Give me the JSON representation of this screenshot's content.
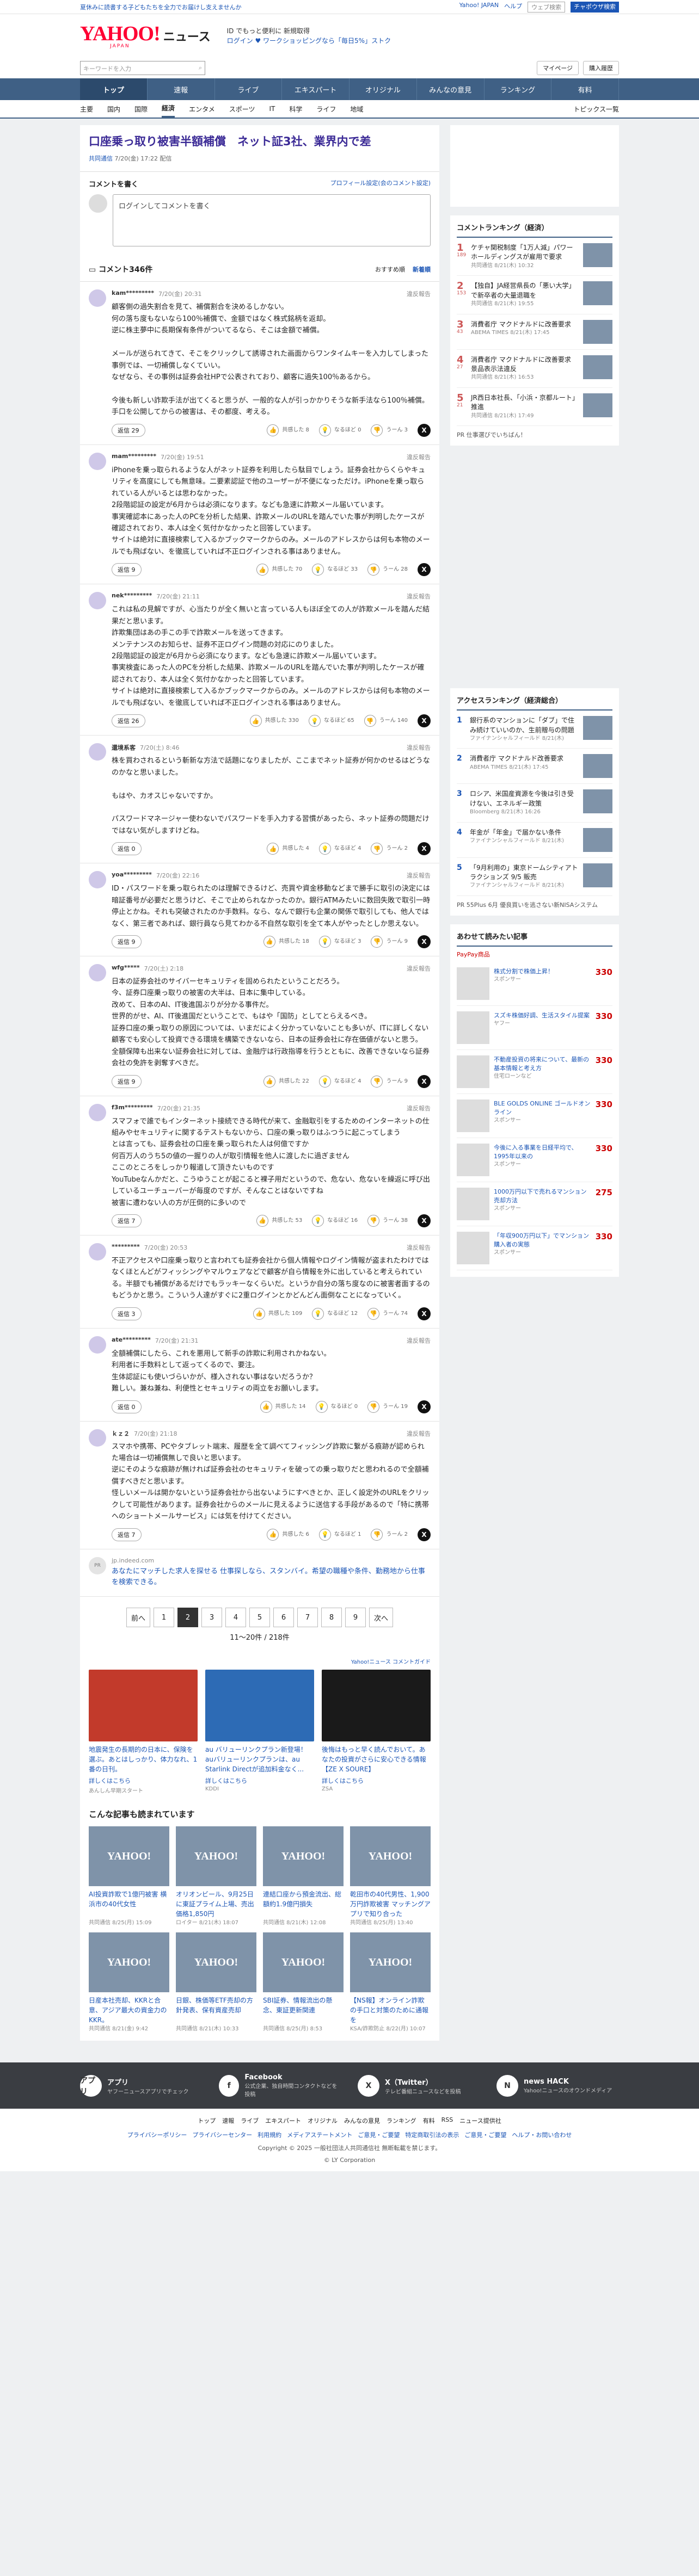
{
  "topbar": {
    "promo": "夏休みに読書する子どもたちを全力でお届けし支えませんか",
    "links": [
      "Yahoo! JAPAN",
      "ヘルプ"
    ],
    "search_placeholder": "ウェブ検索",
    "search_btn": "チャポウザ検索"
  },
  "header": {
    "logo": "YAHOO!",
    "logo_sub": "JAPAN",
    "suffix": "ニュース",
    "promo1": "ID でもっと便利に 新規取得",
    "promo2": "ログイン  ♥ ワークショッピングなら「毎日5%」ストク"
  },
  "searchrow": {
    "placeholder": "キーワードを入力",
    "mypage": "マイページ",
    "buy": "購入履歴"
  },
  "nav": [
    "トップ",
    "速報",
    "ライブ",
    "エキスパート",
    "オリジナル",
    "みんなの意見",
    "ランキング",
    "有料"
  ],
  "subnav": [
    "主要",
    "国内",
    "国際",
    "経済",
    "エンタメ",
    "スポーツ",
    "IT",
    "科学",
    "ライフ",
    "地域"
  ],
  "subnav_right": "トピックス一覧",
  "article": {
    "title": "口座乗っ取り被害半額補償　ネット証3社、業界内で差",
    "source": "共同通信",
    "date": "7/20(金) 17:22 配信"
  },
  "comment_form": {
    "label": "コメントを書く",
    "profile": "プロフィール設定(会のコメント設定)",
    "placeholder": "ログインしてコメントを書く"
  },
  "comments_bar": {
    "title": "コメント346件",
    "sort1": "おすすめ順",
    "sort2": "新着順"
  },
  "comments": [
    {
      "name": "kam*********",
      "date": "7/20(金) 20:31",
      "report": "違反報告",
      "text": "顧客側の過失割合を見て、補償割合を決めるしかない。\n何の落ち度もないなら100％補償で、金額ではなく株式銘柄を返却。\n逆に株主夢中に長期保有条件がついてるなら、そこは金額で補償。\n\nメールが送られてきて、そこをクリックして誘導された画面からワンタイムキーを入力してしまった事例では、一切補償しなくていい。\nなぜなら、その事例は証券会社HPで公表されており、顧客に過失100％あるから。\n\n今後も新しい詐欺手法が出てくると思うが、一般的な人が引っかかりそうな新手法なら100％補償。\n手口を公開してからの被害は、その都度、考える。",
      "replies": "返信 29",
      "good": "共感した 8",
      "good_n": "8",
      "hmm": "なるほど 0",
      "hmm_n": "0",
      "bad": "うーん 3",
      "bad_n": "3"
    },
    {
      "name": "mam*********",
      "date": "7/20(金) 19:51",
      "report": "違反報告",
      "text": "iPhoneを乗っ取られるような人がネット証券を利用したら駄目でしょう。証券会社からくらやキュリティを高度にしても無意味。二要素認証で他のユーザーが不便になっただけ。iPhoneを乗っ取られている人がいるとは思わなかった。\n2段階認証の設定が6月からは必須になります。なども急速に詐欺メール届いています。\n事実確認本にあった人のPCを分析した結果、詐欺メールのURLを踏んでいた事が判明したケースが確認されており、本人は全く気付かなかったと回答しています。\nサイトは絶対に直接検索して入るかブックマークからのみ。メールのアドレスからは何も本物のメールでも飛ばない、を徹底していれば不正ログインされる事はありません。",
      "replies": "返信 9",
      "good": "共感した 70",
      "good_n": "70",
      "hmm": "なるほど 33",
      "hmm_n": "33",
      "bad": "うーん 28",
      "bad_n": "28"
    },
    {
      "name": "nek*********",
      "date": "7/20(金) 21:11",
      "report": "違反報告",
      "text": "これは私の見解ですが、心当たりが全く無いと言っている人もほぼ全ての人が詐欺メールを踏んだ結果だと思います。\n詐欺集団はあの手この手で詐欺メールを送ってきます。\nメンテナンスのお知らせ、証券不正ログイン問題の対応にのりました。\n2段階認証の設定が6月から必須になります。なども急速に詐欺メール届いています。\n事実検査にあった人のPCを分析した結果、詐欺メールのURLを踏んでいた事が判明したケースが確認されており、本人は全く気付かなかったと回答しています。\nサイトは絶対に直接検索して入るかブックマークからのみ。メールのアドレスからは何も本物のメールでも飛ばない、を徹底していれば不正ログインされる事はありません。",
      "replies": "返信 26",
      "good": "共感した 330",
      "good_n": "330",
      "hmm": "なるほど 65",
      "hmm_n": "65",
      "bad": "うーん 140",
      "bad_n": "140"
    },
    {
      "name": "還境系客",
      "date": "7/20(土) 8:46",
      "report": "違反報告",
      "text": "株を買わされるという斬新な方法で話題になりましたが、ここまでネット証券が何かのせるはどうなのかなと思いました。\n\nもはや、カオスじゃないですか。\n\nパスワードマネージャー使わないでパスワードを手入力する習慣があったら、ネット証券の問題だけではない気がしますけどね。",
      "replies": "返信 0",
      "good": "共感した 4",
      "good_n": "4",
      "hmm": "なるほど 4",
      "hmm_n": "4",
      "bad": "うーん 2",
      "bad_n": "2"
    },
    {
      "name": "yoa*********",
      "date": "7/20(金) 22:16",
      "report": "違反報告",
      "text": "ID・パスワードを乗っ取られたのは理解できるけど、売買や資金移動などまで勝手に取引の決定には暗証番号が必要だと思うけど、そこで止められなかったのか。銀行ATMみたいに数回失敗で取引一時停止とかね。それも突破されたのか手数料。なら、なんで銀行も企業の関係で取引しても、他人ではなく、第三者であれば、銀行員なら見てわかる不自然な取引を全て本人がやったとしか思えない。",
      "replies": "返信 9",
      "good": "共感した 18",
      "good_n": "18",
      "hmm": "なるほど 3",
      "hmm_n": "3",
      "bad": "うーん 9",
      "bad_n": "9"
    },
    {
      "name": "wfg*****",
      "date": "7/20(土) 2:18",
      "report": "違反報告",
      "text": "日本の証券会社のサイバーセキュリティを固められたということだろう。\n今、証券口座乗っ取りの被害の大半は、日本に集中している。\n改めて、日本のAI、IT後進国ぶりが分かる事件だ。\n世界的がせ、AI、IT後進国だということで、もはや「国防」としてとらえるべき。\n証券口座の乗っ取りの原因については、いまだによく分かっていないことも多いが、ITに詳しくない顧客でも安心して投資できる環境を構築できないなら、日本の証券会社に存在価値がないと思う。\n全額保障も出来ない証券会社に対しては、金融庁は行政指導を行うとともに、改善できないなら証券会社の免許を剥奪すべきだ。",
      "replies": "返信 9",
      "good": "共感した 22",
      "good_n": "22",
      "hmm": "なるほど 4",
      "hmm_n": "4",
      "bad": "うーん 9",
      "bad_n": "9"
    },
    {
      "name": "f3m*********",
      "date": "7/20(金) 21:35",
      "report": "違反報告",
      "text": "スマフォで誰でもインターネット接続できる時代が来て、金融取引をするためのインターネットの仕組みやセキュリティに関するテストもないから、口座の乗っ取りはふつうに起こってしまう\nとは言っても、証券会社の口座を乗っ取られた人は何億ですか\n何百万人のうち5の値の一握りの人が取引情報を他人に渡したに過ぎません\nここのところをしっかり報道して頂きたいものです\nYouTubeなんかだと、こうゆうことが起こると裸子用だというので、危ない、危ないを繰返に呼び出しているユーチューバーが毎度のですが、そんなことはないですね\n被害に遭わない人の方が圧倒的に多いので",
      "replies": "返信 7",
      "good": "共感した 53",
      "good_n": "53",
      "hmm": "なるほど 16",
      "hmm_n": "16",
      "bad": "うーん 38",
      "bad_n": "38"
    },
    {
      "name": "*********",
      "date": "7/20(金) 20:53",
      "report": "違反報告",
      "text": "不正アクセスや口座乗っ取りと言われても証券会社から個人情報やログイン情報が盗まれたわけではなくほとんどがフィッシングやマルウェアなどで顧客が自ら情報を外に出していると考えられている。半額でも補償があるだけでもラッキーなくらいだ。というか自分の落ち度なのに被害者面するのもどうかと思う。こういう人達がすぐに2重ログインとかどんどん面倒なことになっていく。",
      "replies": "返信 3",
      "good": "共感した 109",
      "good_n": "109",
      "hmm": "なるほど 12",
      "hmm_n": "12",
      "bad": "うーん 74",
      "bad_n": "74"
    },
    {
      "name": "ate*********",
      "date": "7/20(金) 21:31",
      "report": "違反報告",
      "text": "全額補償にしたら、これを悪用して新手の詐欺に利用されかねない。\n利用者に手数料として返ってくるので、要注。\n生体認証にも使いづらいかが、様入されない事はないだろうか？\n難しい。兼ね兼ね、利便性とセキュリティの両立をお願いします。",
      "replies": "返信 0",
      "good": "共感した 14",
      "good_n": "14",
      "hmm": "なるほど 0",
      "hmm_n": "0",
      "bad": "うーん 19",
      "bad_n": "19"
    },
    {
      "name": "ｋｚ２",
      "date": "7/20(金) 21:18",
      "report": "違反報告",
      "text": "スマホや携帯、PCやタブレット端末、履歴を全て調べてフィッシング詐欺に繋がる痕跡が認められた場合は一切補償無しで良いと思います。\n逆にそのような痕跡が無ければ証券会社のセキュリティを破っての乗っ取りだと思われるので全額補償すべきだと思います。\n怪しいメールは開かないという証券会社から出ないようにすべきとか、正しく設定外のURLをクリックして可能性があります。証券会社からのメールに見えるように送信する手段があるので「特に携帯へのショートメールサービス」には気を付けてください。",
      "replies": "返信 7",
      "good": "共感した 6",
      "good_n": "6",
      "hmm": "なるほど 1",
      "hmm_n": "1",
      "bad": "うーん 2",
      "bad_n": "2"
    }
  ],
  "ad_inline": {
    "src": "jp.indeed.com",
    "label": "PR",
    "text": "あなたにマッチした求人を探せる 仕事探しなら、スタンバイ。希望の職種や条件、勤務地から仕事を検索できる。"
  },
  "pager": {
    "prev": "前へ",
    "pages": [
      "1",
      "2",
      "3",
      "4",
      "5",
      "6",
      "7",
      "8",
      "9"
    ],
    "current": "2",
    "next": "次へ",
    "info": "11〜20件 / 218件"
  },
  "ad_section": {
    "label": "Yahoo!ニュース コメントガイド",
    "cards": [
      {
        "cap": "地震発生の長期的の日本に、保険を選ぶ。あとはしっかり、体力なれ、1番の日刊。",
        "more": "詳しくはこちら",
        "sp": "あんしん早期スタート"
      },
      {
        "cap": "au バリューリンクプラン新登場！ auバリューリンクプランは、au Starlink Directが追加料金なく...",
        "more": "詳しくはこちら",
        "sp": "KDDI"
      },
      {
        "cap": "後悔はもっと早く読んでおいて。あなたの投資がさらに安心できる情報【ZE X SOURE】",
        "more": "詳しくはこちら",
        "sp": "ZSA"
      }
    ]
  },
  "related": {
    "title": "こんな記事も読まれています",
    "cards": [
      {
        "t": "AI投資詐欺で1億円被害 横浜市の40代女性",
        "m": "共同通信 8/25(月) 15:09"
      },
      {
        "t": "オリオンビール、9月25日に東証プライム上場、売出価格1,850円",
        "m": "ロイター 8/21(木) 18:07"
      },
      {
        "t": "連結口座から預金流出、総額約1.9億円損失",
        "m": "共同通信 8/21(木) 12:08"
      },
      {
        "t": "乾田市の40代男性、1,900万円詐欺被害 マッチングアプリで知り合った",
        "m": "共同通信 8/25(月) 13:40"
      },
      {
        "t": "日産本社売却、KKRと合意、アジア最大の資金力のKKR。",
        "m": "共同通信 8/21(金) 9:42"
      },
      {
        "t": "日銀、株価等ETF売却の方針発表、保有資産売却",
        "m": "共同通信 8/21(木) 10:33"
      },
      {
        "t": "SBI証券、情報流出の懸念、東証更新関連",
        "m": "共同通信 8/25(月) 8:53"
      },
      {
        "t": "【NS報】オンライン詐欺の手口と対策のために通報を",
        "m": "KSA/詐欺防止 8/22(月) 10:07"
      }
    ]
  },
  "side_rank1": {
    "title": "コメントランキング（経済）",
    "items": [
      {
        "n": "1",
        "cnt": "189",
        "t": "ケチャ関税制度「1万人減」パワーホールディングスが雇用で要求",
        "s": "共同通信 8/21(木) 10:32"
      },
      {
        "n": "2",
        "cnt": "153",
        "t": "【独自】JA経営県長の「悪い大学」で新卒者の大量退職を",
        "s": "共同通信 8/21(木) 19:55"
      },
      {
        "n": "3",
        "cnt": "43",
        "t": "消費者庁 マクドナルドに改善要求",
        "s": "ABEMA TIMES 8/21(木) 17:45"
      },
      {
        "n": "4",
        "cnt": "27",
        "t": "消費者庁 マクドナルドに改善要求 景品表示法違反",
        "s": "共同通信 8/21(木) 16:53"
      },
      {
        "n": "5",
        "cnt": "21",
        "t": "JR西日本社長、「小浜・京都ルート」推進",
        "s": "共同通信 8/21(木) 17:49"
      }
    ],
    "pr": "PR 仕事選びでいちばん！"
  },
  "side_rank2": {
    "title": "アクセスランキング（経済総合）",
    "items": [
      {
        "n": "1",
        "t": "銀行系のマンションに「ダブ」で住み続けていいのか、生前贈与の問題",
        "s": "ファイナンシャルフィールド 8/21(木)"
      },
      {
        "n": "2",
        "t": "消費者庁 マクドナルド改善要求",
        "s": "ABEMA TIMES 8/21(木) 17:45"
      },
      {
        "n": "3",
        "t": "ロシア、米国産資源を今後は引き受けない、エネルギー政策",
        "s": "Bloomberg 8/21(木) 16:26"
      },
      {
        "n": "4",
        "t": "年金が「年金」で届かない条件",
        "s": "ファイナンシャルフィールド 8/21(木)"
      },
      {
        "n": "5",
        "t": "「9月利用の」東京ドームシティアトラクションズ 9/5 販売",
        "s": "ファイナンシャルフィールド 8/21(木)"
      }
    ],
    "pr": "PR 55Plus 6月 優良買いを逃さない新NISAシステム"
  },
  "side_shop": {
    "title": "あわせて読みたい記事",
    "badge": "PayPay商品",
    "items": [
      {
        "t": "株式分割で株価上昇！",
        "s": "スポンサー",
        "p": "330"
      },
      {
        "t": "スズキ株価好調、生活スタイル提案",
        "s": "ヤフー",
        "p": "330"
      },
      {
        "t": "不動産投資の将来について、最新の基本情報と考え方",
        "s": "住宅ローンなど",
        "p": "330"
      },
      {
        "t": "BLE GOLDS ONLINE ゴールドオンライン",
        "s": "スポンサー",
        "p": "330"
      },
      {
        "t": "今後に入る事業を日経平均で、1995年以来の",
        "s": "スポンサー",
        "p": "330"
      },
      {
        "t": "1000万円以下で売れるマンション売却方法",
        "s": "スポンサー",
        "p": "275"
      },
      {
        "t": "「年収900万円以下」でマンション購入者の実態",
        "s": "スポンサー",
        "p": "330"
      }
    ]
  },
  "footer": {
    "items": [
      {
        "icon": "アプリ",
        "t": "アプリ",
        "d": "ヤフーニュースアプリでチェック"
      },
      {
        "icon": "f",
        "t": "Facebook",
        "d": "公式企業、独自時間コンタクトなどを投稿"
      },
      {
        "icon": "X",
        "t": "X（Twitter）",
        "d": "テレビ番組ニュースなどを投稿"
      },
      {
        "icon": "N",
        "t": "news HACK",
        "d": "Yahoo!ニュースのオウンドメディア"
      }
    ],
    "links": [
      "トップ",
      "速報",
      "ライブ",
      "エキスパート",
      "オリジナル",
      "みんなの意見",
      "ランキング",
      "有料",
      "RSS",
      "ニュース提供社"
    ],
    "links2": [
      "プライバシーポリシー",
      "プライバシーセンター",
      "利用規約",
      "メディアステートメント",
      "ご意見・ご要望",
      "特定商取引法の表示",
      "ご意見・ご要望",
      "ヘルプ・お問い合わせ"
    ],
    "copy": "Copyright © 2025 一般社団法人共同通信社 無断転載を禁じます。",
    "copy2": "© LY Corporation"
  }
}
